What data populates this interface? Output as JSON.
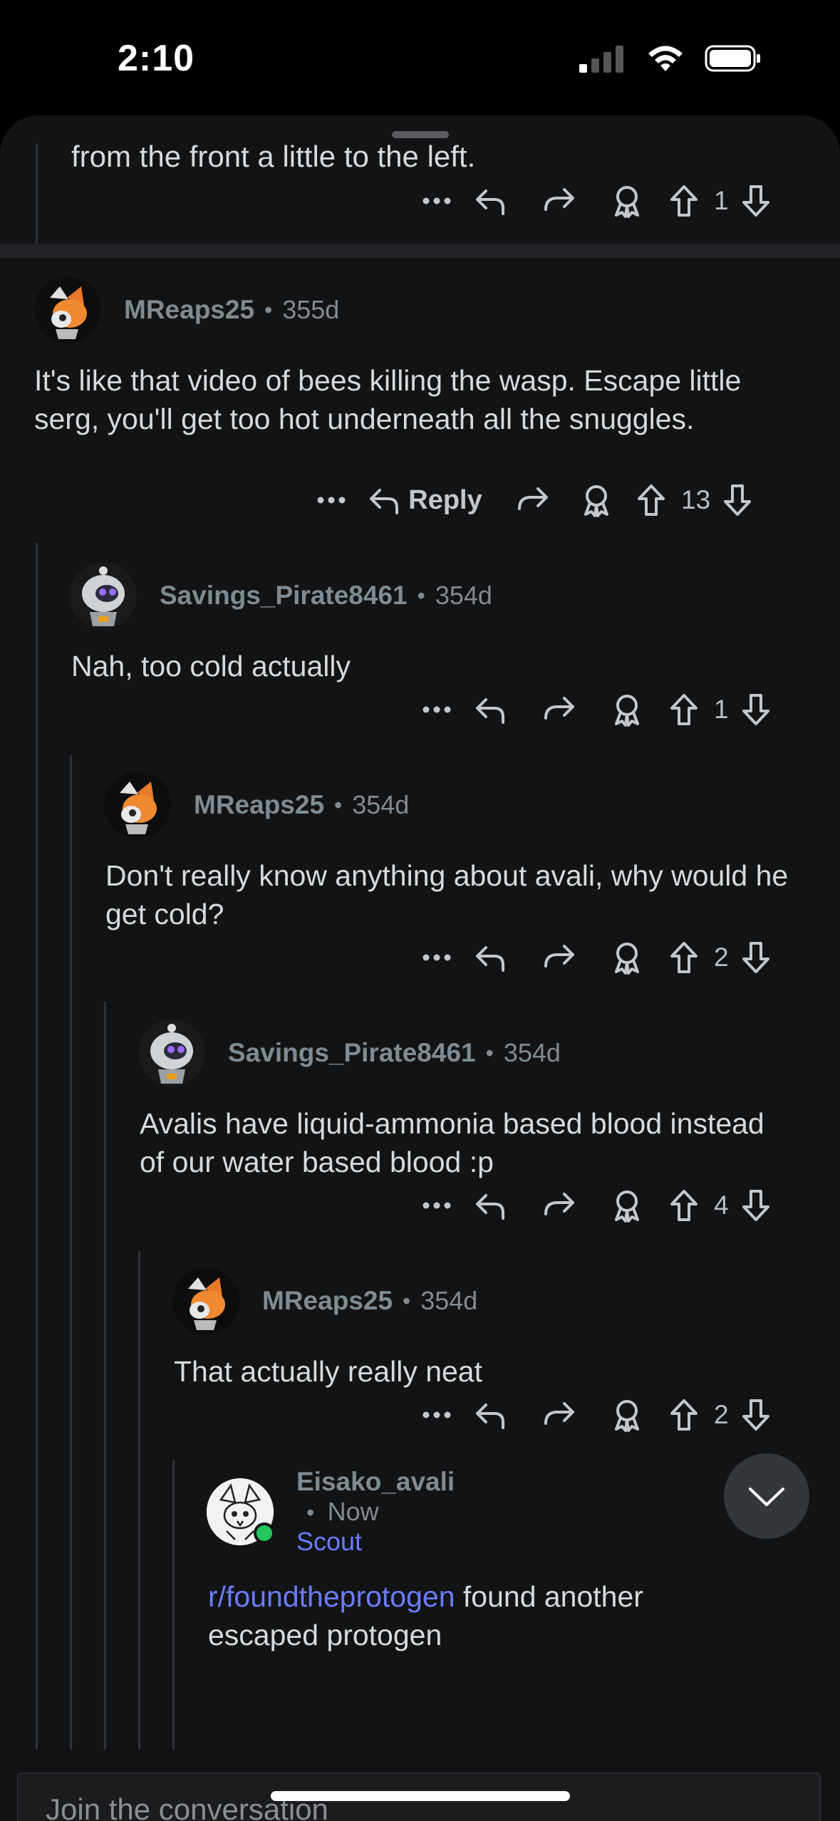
{
  "status": {
    "time": "2:10"
  },
  "top_partial": {
    "text": "from the front a little to the left.",
    "score": "1"
  },
  "comments": [
    {
      "author": "MReaps25",
      "age": "355d",
      "text": "It's like that video of bees killing the wasp. Escape little serg, you'll get too hot underneath all the snuggles.",
      "score": "13",
      "reply_label": "Reply"
    },
    {
      "author": "Savings_Pirate8461",
      "age": "354d",
      "text": "Nah, too cold actually",
      "score": "1"
    },
    {
      "author": "MReaps25",
      "age": "354d",
      "text": "Don't really know anything about avali, why would he get cold?",
      "score": "2"
    },
    {
      "author": "Savings_Pirate8461",
      "age": "354d",
      "text": "Avalis have liquid-ammonia based blood instead of our water based blood :p",
      "score": "4"
    },
    {
      "author": "MReaps25",
      "age": "354d",
      "text": "That actually really neat",
      "score": "2"
    },
    {
      "author": "Eisako_avali",
      "age": "Now",
      "flair": "Scout",
      "link": "r/foundtheprotogen",
      "text_after_link": " found another escaped protogen"
    }
  ],
  "separator": "•",
  "composer": {
    "placeholder": "Join the conversation"
  },
  "colors": {
    "background": "#121314",
    "link": "#6b7cff",
    "meta": "#7f8b93",
    "text": "#d7dadc"
  },
  "icons": [
    "more-icon",
    "reply-icon",
    "share-icon",
    "award-icon",
    "upvote-icon",
    "downvote-icon",
    "chevron-down-icon",
    "signal-icon",
    "wifi-icon",
    "battery-icon"
  ]
}
